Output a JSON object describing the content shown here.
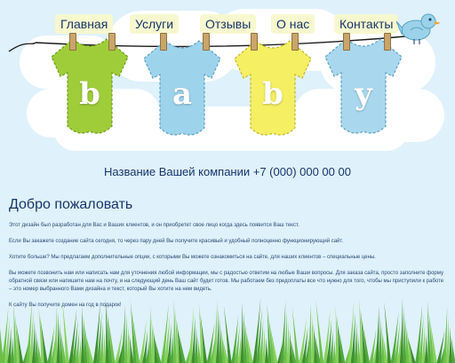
{
  "nav": {
    "items": [
      {
        "label": "Главная"
      },
      {
        "label": "Услуги"
      },
      {
        "label": "Отзывы"
      },
      {
        "label": "О нас"
      },
      {
        "label": "Контакты"
      }
    ]
  },
  "header": {
    "letters": [
      "b",
      "a",
      "b",
      "y"
    ],
    "company_line": "Название Вашей компании +7 (000) 000 00 00"
  },
  "main": {
    "title": "Добро пожаловать",
    "paragraphs": [
      "Этот дизайн был разработан для Вас и Ваших клиентов, и он приобретет свое лицо когда здесь появится Ваш текст.",
      "Если Вы закажете создание сайта сегодня, то через пару дней Вы получите красивый и удобный полноценно функционирующий сайт.",
      "Хотите больше? Мы предлагаем дополнительные опции, с которыми Вы можете ознакомиться на сайте, для наших клиентов – специальные цены.",
      "Вы можете позвонить нам или написать нам для уточнения любой информации, мы с радостью ответим на любые Ваши вопросы. Для заказа сайта, просто заполните форму обратной связи или напишите нам на почту, и на следующий день Ваш сайт будет готов. Мы работаем без предоплаты все что нужно для того, чтобы мы приступили к работе – это номер выбранного Вами дизайна и текст, который Вы хотите на нем видеть.",
      "К сайту Вы получите домен на год в подарок!"
    ]
  },
  "colors": {
    "green": "#9fcd3a",
    "blue": "#9ed3ec",
    "yellow": "#f5ef63",
    "light_blue": "#a9d8ee",
    "bird": "#9cd2e9",
    "grass": "#6cc04a",
    "nav_bg": "#f7f8cf"
  }
}
